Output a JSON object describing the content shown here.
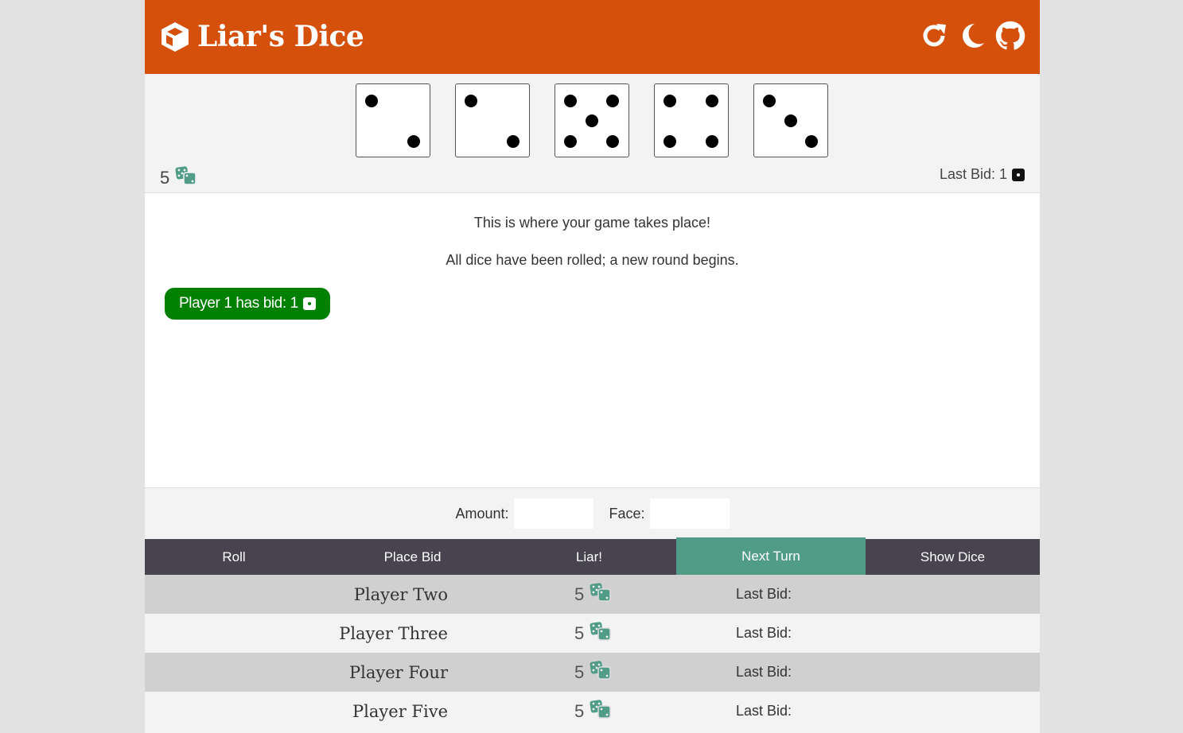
{
  "header": {
    "title": "Liar's Dice",
    "icons": [
      "cube-icon",
      "restart-icon",
      "moon-icon",
      "github-icon"
    ]
  },
  "player": {
    "dice": [
      2,
      2,
      5,
      4,
      3
    ],
    "dice_count": "5",
    "last_bid_label": "Last Bid: 1"
  },
  "log": {
    "lines": [
      "This is where your game takes place!",
      "All dice have been rolled; a new round begins."
    ],
    "bid_message": "Player 1 has bid: 1"
  },
  "bid_form": {
    "amount_label": "Amount:",
    "face_label": "Face:",
    "amount_value": "",
    "face_value": ""
  },
  "actions": [
    {
      "label": "Roll",
      "active": false
    },
    {
      "label": "Place Bid",
      "active": false
    },
    {
      "label": "Liar!",
      "active": false
    },
    {
      "label": "Next Turn",
      "active": true
    },
    {
      "label": "Show Dice",
      "active": false
    }
  ],
  "opponents": [
    {
      "name": "Player Two",
      "dice_count": "5",
      "last_bid": "Last Bid:"
    },
    {
      "name": "Player Three",
      "dice_count": "5",
      "last_bid": "Last Bid:"
    },
    {
      "name": "Player Four",
      "dice_count": "5",
      "last_bid": "Last Bid:"
    },
    {
      "name": "Player Five",
      "dice_count": "5",
      "last_bid": "Last Bid:"
    }
  ],
  "colors": {
    "header": "#d4500b",
    "action_bar": "#47434f",
    "active_action": "#519c87",
    "bid_pill": "#008000",
    "dice_icon": "#519c87"
  }
}
